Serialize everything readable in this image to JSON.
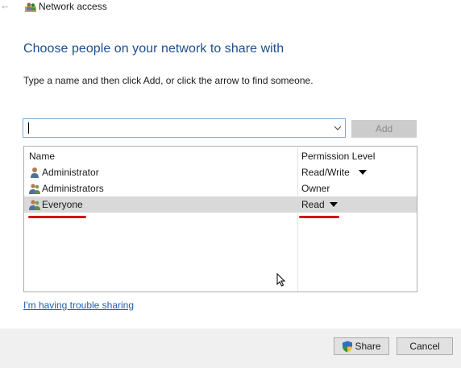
{
  "window": {
    "title": "Network access",
    "back_icon": "back-arrow-icon",
    "title_icon": "users-shared-icon"
  },
  "main": {
    "heading": "Choose people on your network to share with",
    "instructions": "Type a name and then click Add, or click the arrow to find someone.",
    "name_input": {
      "value": "",
      "placeholder": ""
    },
    "add_button": "Add"
  },
  "list": {
    "columns": [
      "Name",
      "Permission Level"
    ],
    "rows": [
      {
        "name": "Administrator",
        "permission": "Read/Write",
        "icon": "user-icon",
        "has_dropdown": true,
        "selected": false
      },
      {
        "name": "Administrators",
        "permission": "Owner",
        "icon": "group-icon",
        "has_dropdown": false,
        "selected": false
      },
      {
        "name": "Everyone",
        "permission": "Read",
        "icon": "group-icon",
        "has_dropdown": true,
        "selected": true
      }
    ]
  },
  "trouble_link": "I'm having trouble sharing",
  "footer": {
    "share_button": "Share",
    "cancel_button": "Cancel"
  },
  "colors": {
    "heading": "#1c4f8e",
    "link": "#1c5fab",
    "selected_row": "#d9d9d9",
    "annotation_underline": "#d4141b",
    "footer_bg": "#f0f0f0"
  }
}
